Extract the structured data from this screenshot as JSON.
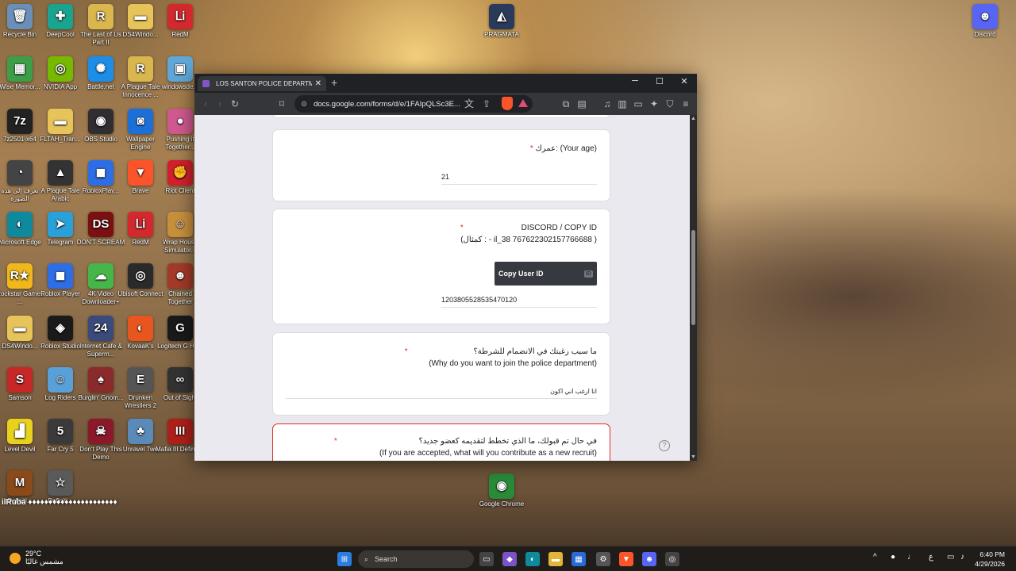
{
  "desktop": {
    "icons": [
      {
        "label": "Recycle Bin",
        "glyph": "🗑",
        "color": "#6b8fb8"
      },
      {
        "label": "DeepCool",
        "glyph": "✚",
        "color": "#1aa38f"
      },
      {
        "label": "The Last of Us Part II",
        "glyph": "R",
        "color": "#d9b64e"
      },
      {
        "label": "DS4Windo...",
        "glyph": "▬",
        "color": "#e6c45a"
      },
      {
        "label": "RedM",
        "glyph": "ᏞᎥ",
        "color": "#d3282e"
      },
      {
        "label": "Wise Memor...",
        "glyph": "▦",
        "color": "#3c9e48"
      },
      {
        "label": "NVIDIA App",
        "glyph": "◎",
        "color": "#76b900"
      },
      {
        "label": "Battle.net",
        "glyph": "✺",
        "color": "#1c8ee8"
      },
      {
        "label": "A Plague Tale Innocence ...",
        "glyph": "R",
        "color": "#d9b64e"
      },
      {
        "label": "windowsde...",
        "glyph": "▣",
        "color": "#5ea7d8"
      },
      {
        "label": "7z2501-x64",
        "glyph": "7z",
        "color": "#222222"
      },
      {
        "label": "FLTAH_Tran...",
        "glyph": "▬",
        "color": "#e6c45a"
      },
      {
        "label": "OBS Studio",
        "glyph": "◉",
        "color": "#302e31"
      },
      {
        "label": "Wallpaper Engine",
        "glyph": "◙",
        "color": "#1d6fd8"
      },
      {
        "label": "Pushing it Together...",
        "glyph": "●",
        "color": "#d05a8f"
      },
      {
        "label": "تعرف إلى هذه الصورة",
        "glyph": "◔",
        "color": "#444444"
      },
      {
        "label": "A Plague Tale Arabic",
        "glyph": "▲",
        "color": "#333333"
      },
      {
        "label": "RobloxPlay...",
        "glyph": "◼",
        "color": "#2d6ee6"
      },
      {
        "label": "Brave",
        "glyph": "▼",
        "color": "#fb542b"
      },
      {
        "label": "Riot Client",
        "glyph": "✊",
        "color": "#d2212d"
      },
      {
        "label": "Microsoft Edge",
        "glyph": "◐",
        "color": "#0f8a9d"
      },
      {
        "label": "Telegram",
        "glyph": "➤",
        "color": "#2aa0da"
      },
      {
        "label": "DON'T SCREAM",
        "glyph": "DS",
        "color": "#7a1010"
      },
      {
        "label": "RedM",
        "glyph": "ᏞᎥ",
        "color": "#d3282e"
      },
      {
        "label": "Wrap House Simulator...",
        "glyph": "☺",
        "color": "#c8903c"
      },
      {
        "label": "Rockstar Games ...",
        "glyph": "R★",
        "color": "#f0b81b"
      },
      {
        "label": "Roblox Player",
        "glyph": "◼",
        "color": "#2d6ee6"
      },
      {
        "label": "4K Video Downloader+",
        "glyph": "☁",
        "color": "#47b64a"
      },
      {
        "label": "Ubisoft Connect",
        "glyph": "◎",
        "color": "#2a2a2a"
      },
      {
        "label": "Chained Together",
        "glyph": "☻",
        "color": "#a43a2a"
      },
      {
        "label": "DS4Windo...",
        "glyph": "▬",
        "color": "#e6c45a"
      },
      {
        "label": "Roblox Studio",
        "glyph": "◈",
        "color": "#1a1a1a"
      },
      {
        "label": "Internet Cafe & Superm...",
        "glyph": "24",
        "color": "#3a4a7a"
      },
      {
        "label": "KovaaK's",
        "glyph": "◐",
        "color": "#e6561e"
      },
      {
        "label": "Logitech G HUB",
        "glyph": "G",
        "color": "#1a1a1a"
      },
      {
        "label": "Samson",
        "glyph": "S",
        "color": "#c62828"
      },
      {
        "label": "Log Riders",
        "glyph": "☺",
        "color": "#5aa0d8"
      },
      {
        "label": "Burglin' Gnom...",
        "glyph": "♠",
        "color": "#8a2a2a"
      },
      {
        "label": "Drunken Wrestlers 2",
        "glyph": "E",
        "color": "#555555"
      },
      {
        "label": "Out of Sight",
        "glyph": "∞",
        "color": "#333333"
      },
      {
        "label": "Level Devil",
        "glyph": "▟",
        "color": "#e8d21e"
      },
      {
        "label": "Far Cry 5",
        "glyph": "5",
        "color": "#3a3a3a"
      },
      {
        "label": "Don't Play This Demo",
        "glyph": "☠",
        "color": "#8a1a2a"
      },
      {
        "label": "Unravel Two",
        "glyph": "♣",
        "color": "#5a8ab8"
      },
      {
        "label": "Mafia III Definiti...",
        "glyph": "III",
        "color": "#b0201a"
      },
      {
        "label": "Definiti...",
        "glyph": "M",
        "color": "#8a4a1a"
      },
      {
        "label": "Definiti...",
        "glyph": "☆",
        "color": "#5a5a5a"
      },
      {
        "label": "PRAGMATA",
        "glyph": "◭",
        "color": "#2a3a5a"
      },
      {
        "label": "Google Chrome",
        "glyph": "◉",
        "color": "#2a8a3a"
      },
      {
        "label": "Discord",
        "glyph": "☻",
        "color": "#5865f2"
      }
    ],
    "marquee": "ilRuba ♦♦♦♦♦♦♦♦♦♦♦♦♦♦♦♦♦♦♦♦♦♦"
  },
  "browser": {
    "tab_title": "LOS SANTON POLICE DEPARTMENT",
    "new_tab": "+",
    "url": "docs.google.com/forms/d/e/1FAIpQLSc3E...",
    "window": {
      "minimize": "─",
      "maximize": "☐",
      "close": "✕"
    }
  },
  "form": {
    "q_age_label": "عمرك: (Your age)",
    "q_age_answer": "21",
    "q_discord_line1": "DISCORD /   COPY ID",
    "q_discord_line2": "(كمثال : - il_38 767622302157766688  )",
    "copy_btn_label": "Copy User ID",
    "copy_btn_badge": "ID",
    "q_discord_answer": "1203805528535470120",
    "q_reason_line1": "ما سبب رغبتك في الانضمام للشرطة؟",
    "q_reason_line2": "(Why do you want to join the police department)",
    "q_reason_answer": "انا ارغب اني اكون",
    "q_contrib_line1": "في حال تم قبولك، ما الذي تخطط لتقديمه كعضو جديد؟",
    "q_contrib_line2": "(If you are accepted, what will you contribute as a new recruit)",
    "required_mark": "*",
    "help": "?"
  },
  "taskbar": {
    "temp": "29°C",
    "weather_text": "مشمس غالبًا",
    "search_label": "Search",
    "lang": "ع",
    "time": "6:40 PM",
    "date": "4/29/2026"
  }
}
